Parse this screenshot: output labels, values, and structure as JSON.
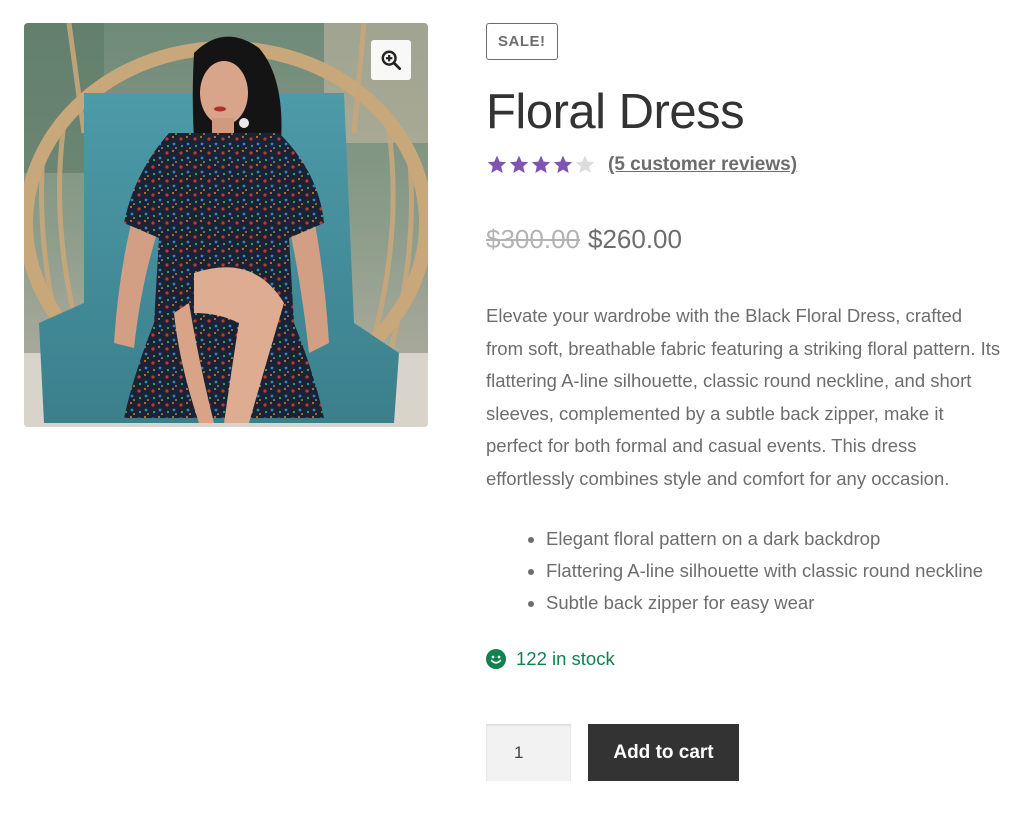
{
  "product": {
    "sale_badge": "SALE!",
    "title": "Floral Dress",
    "rating": 4,
    "rating_max": 5,
    "review_link": "(5 customer reviews)",
    "price_old": "$300.00",
    "price_new": "$260.00",
    "description": "Elevate your wardrobe with the Black Floral Dress, crafted from soft, breathable fabric featuring a striking floral pattern. Its flattering A-line silhouette, classic round neckline, and short sleeves, complemented by a subtle back zipper, make it perfect for both formal and casual events. This dress effortlessly combines style and comfort for any occasion.",
    "features": [
      "Elegant floral pattern on a dark backdrop",
      "Flattering A-line silhouette with classic round neckline",
      "Subtle back zipper for easy wear"
    ],
    "stock": "122 in stock",
    "quantity": "1",
    "add_to_cart_label": "Add to cart"
  },
  "icons": {
    "zoom": "zoom-in-icon",
    "star": "star-icon",
    "stock": "smiley-icon"
  },
  "colors": {
    "star_filled": "#7f54b3",
    "star_empty": "#dddddd",
    "stock": "#0f834d",
    "button_bg": "#333333",
    "title": "#333333",
    "text": "#6d6d6d"
  }
}
